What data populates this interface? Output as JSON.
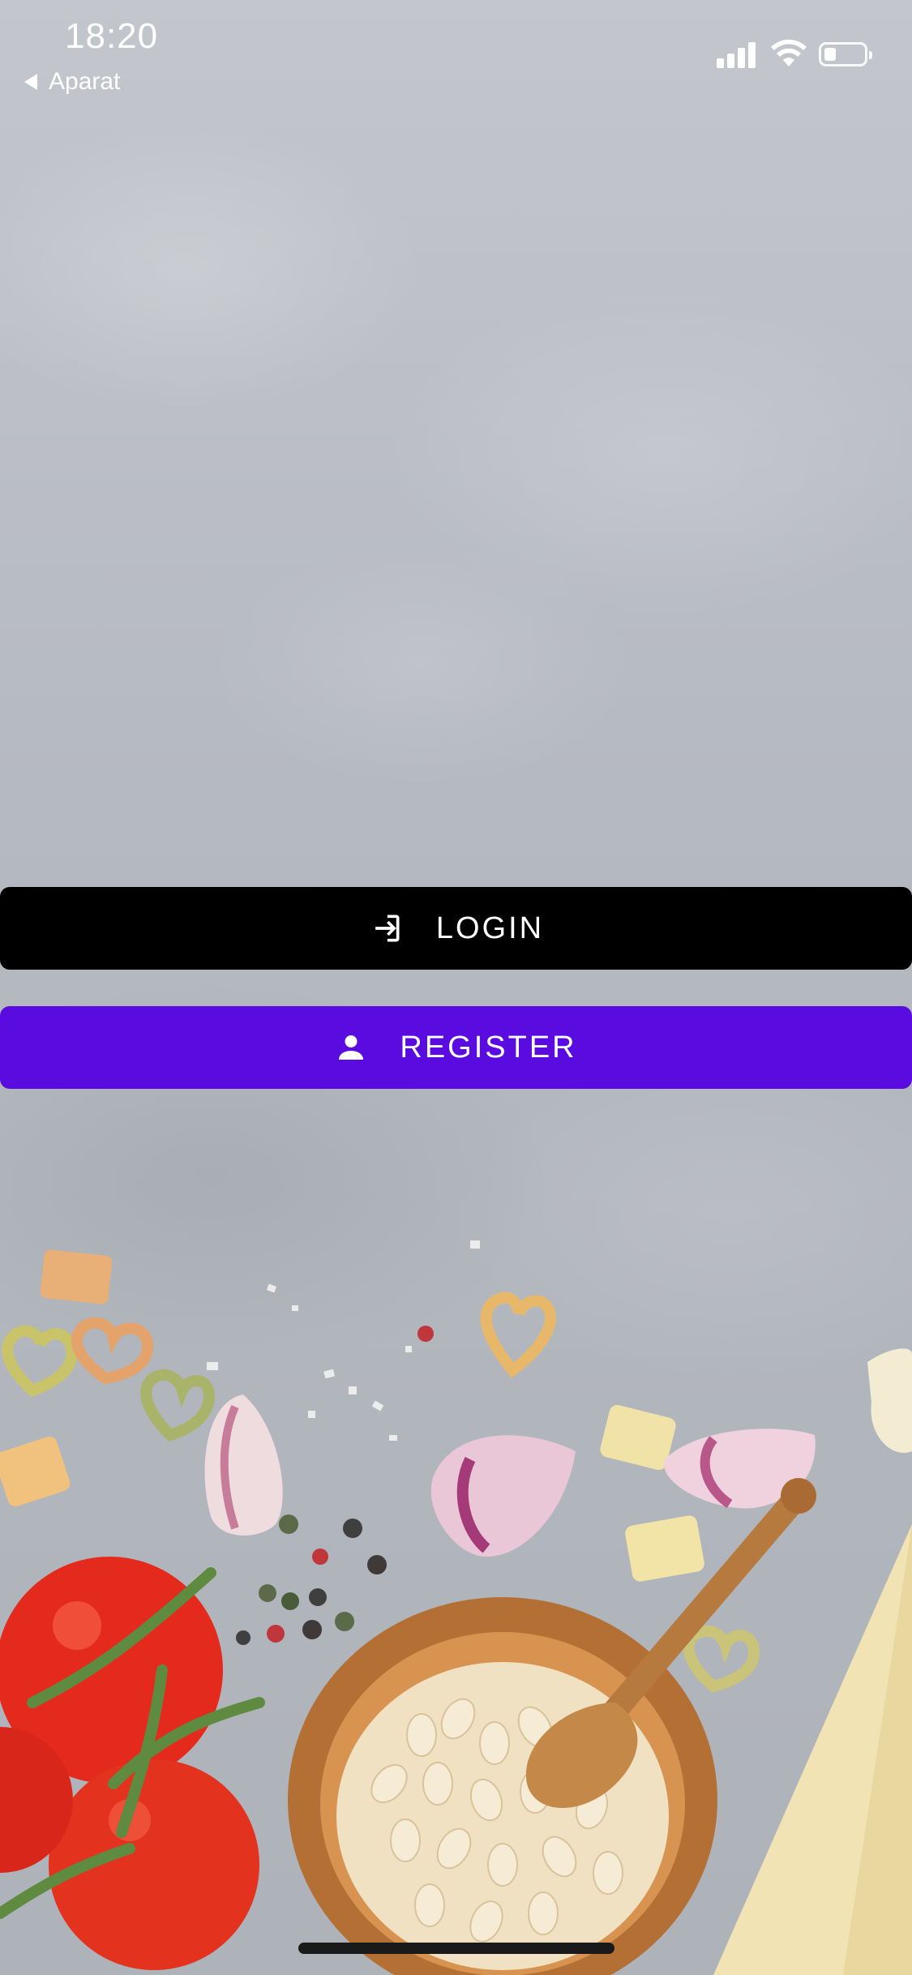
{
  "status_bar": {
    "time": "18:20",
    "back_app_label": "Aparat",
    "battery_level": 0.3
  },
  "buttons": {
    "login": {
      "label": "LOGIN",
      "icon": "login-icon",
      "color": "#000000"
    },
    "register": {
      "label": "REGISTER",
      "icon": "person-icon",
      "color": "#5a0ce0"
    }
  },
  "background": {
    "description_icons": [
      "tomato",
      "garlic",
      "pasta-heart",
      "pine-nuts-bowl",
      "wooden-scoop",
      "cheese",
      "peppercorns",
      "salt"
    ]
  }
}
